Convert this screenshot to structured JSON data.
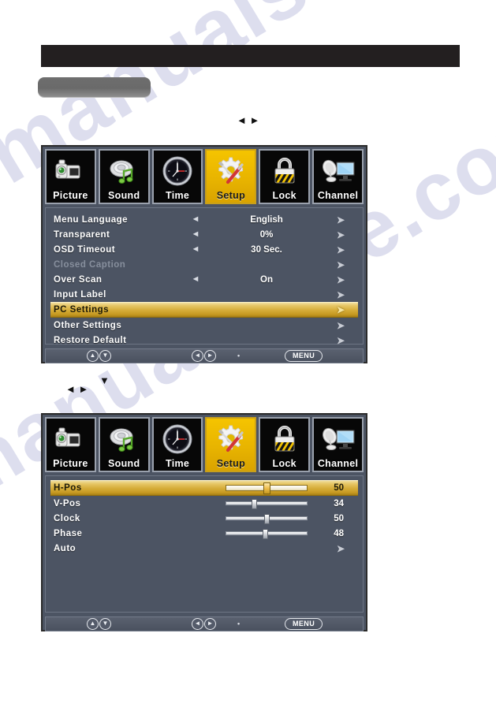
{
  "page": {
    "header_bar_text": "",
    "tag_button_text": "",
    "watermark_text": "manualshive.com"
  },
  "hints": [
    {
      "id": "hint-a",
      "glyphs": "◄ ►",
      "text": ""
    },
    {
      "id": "hint-b",
      "glyphs": "◄ ►",
      "text": ""
    },
    {
      "id": "hint-c",
      "glyphs": "▼",
      "text": ""
    }
  ],
  "tabs": [
    {
      "label": "Picture",
      "icon": "camcorder-icon",
      "selected": false
    },
    {
      "label": "Sound",
      "icon": "speaker-music-note-icon",
      "selected": false
    },
    {
      "label": "Time",
      "icon": "clock-icon",
      "selected": false
    },
    {
      "label": "Setup",
      "icon": "gear-screwdriver-icon",
      "selected": true
    },
    {
      "label": "Lock",
      "icon": "padlock-icon",
      "selected": false
    },
    {
      "label": "Channel",
      "icon": "satellite-tv-icon",
      "selected": false
    }
  ],
  "setup_menu": {
    "rows": [
      {
        "label": "Menu Language",
        "left_arrow": "◄",
        "value": "English",
        "right_arrow": "➤",
        "highlight": false,
        "disabled": false
      },
      {
        "label": "Transparent",
        "left_arrow": "◄",
        "value": "0%",
        "right_arrow": "➤",
        "highlight": false,
        "disabled": false
      },
      {
        "label": "OSD Timeout",
        "left_arrow": "◄",
        "value": "30 Sec.",
        "right_arrow": "➤",
        "highlight": false,
        "disabled": false
      },
      {
        "label": "Closed Caption",
        "left_arrow": "",
        "value": "",
        "right_arrow": "➤",
        "highlight": false,
        "disabled": true
      },
      {
        "label": "Over Scan",
        "left_arrow": "◄",
        "value": "On",
        "right_arrow": "➤",
        "highlight": false,
        "disabled": false
      },
      {
        "label": "Input Label",
        "left_arrow": "",
        "value": "",
        "right_arrow": "➤",
        "highlight": false,
        "disabled": false
      },
      {
        "label": "PC Settings",
        "left_arrow": "",
        "value": "",
        "right_arrow": "➤",
        "highlight": true,
        "disabled": false
      },
      {
        "label": "Other Settings",
        "left_arrow": "",
        "value": "",
        "right_arrow": "➤",
        "highlight": false,
        "disabled": false
      },
      {
        "label": "Restore Default",
        "left_arrow": "",
        "value": "",
        "right_arrow": "➤",
        "highlight": false,
        "disabled": false
      }
    ]
  },
  "pc_settings_menu": {
    "rows": [
      {
        "label": "H-Pos",
        "type": "slider",
        "value": 50,
        "percent": 50,
        "highlight": true
      },
      {
        "label": "V-Pos",
        "type": "slider",
        "value": 34,
        "percent": 34,
        "highlight": false
      },
      {
        "label": "Clock",
        "type": "slider",
        "value": 50,
        "percent": 50,
        "highlight": false
      },
      {
        "label": "Phase",
        "type": "slider",
        "value": 48,
        "percent": 48,
        "highlight": false
      },
      {
        "label": "Auto",
        "type": "link",
        "right_arrow": "➤",
        "highlight": false
      }
    ]
  },
  "footer": {
    "up_label": "▲",
    "down_label": "▼",
    "left_label": "◄",
    "right_label": "►",
    "mark": "•",
    "menu_label": "MENU"
  },
  "colors": {
    "osd_background": "#4c5463",
    "highlight_gold": "#d6ad3a",
    "selected_tab": "#e8b400",
    "tab_background": "#070707",
    "text": "#ffffff",
    "disabled_text": "#878f9d",
    "header_bar": "#231f20",
    "tag_button": "#6e6e6e"
  }
}
